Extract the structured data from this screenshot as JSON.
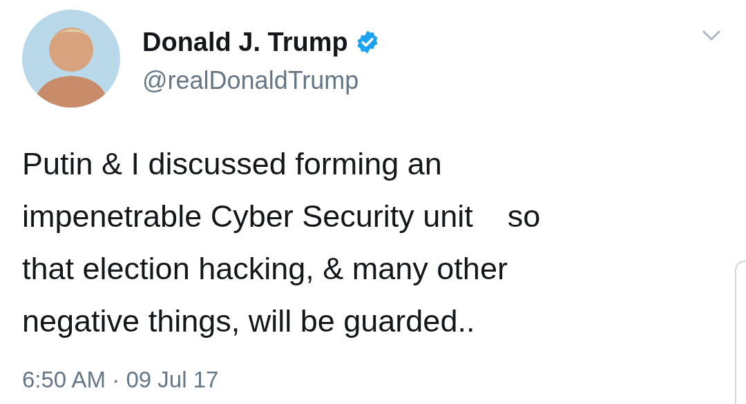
{
  "tweet": {
    "author": {
      "name": "Donald J. Trump",
      "verified": true,
      "handle": "@realDonaldTrump"
    },
    "text": "Putin & I discussed forming an\nimpenetrable Cyber Security unit    so\nthat election hacking, & many other\nnegative things, will be guarded..",
    "timestamp": "6:50 AM · 09 Jul 17"
  }
}
